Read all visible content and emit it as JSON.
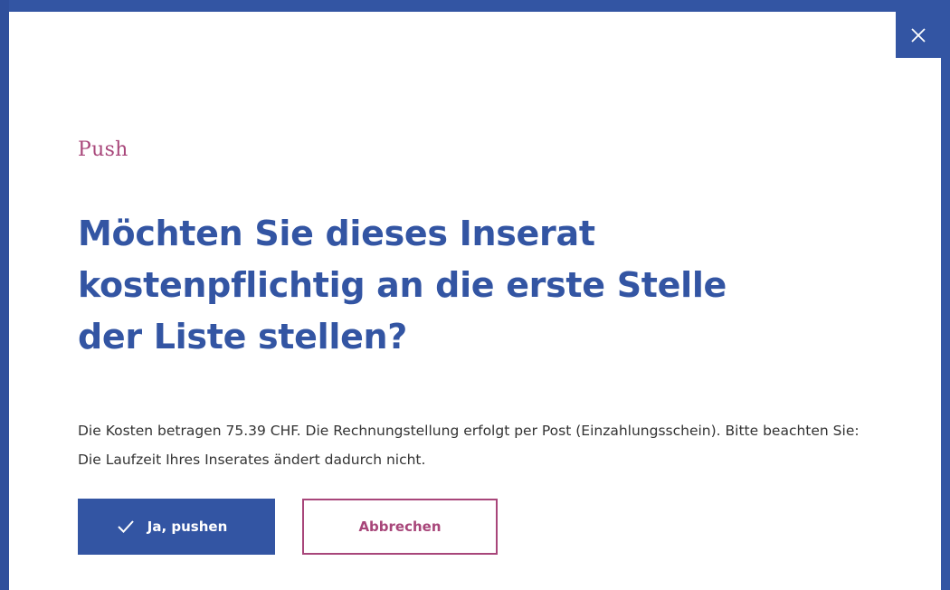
{
  "modal": {
    "eyebrow": "Push",
    "title": "Möchten Sie dieses Inserat kostenpflichtig an die erste Stelle der Liste stellen?",
    "body": "Die Kosten betragen 75.39 CHF. Die Rechnungstellung erfolgt per Post (Einzahlungsschein). Bitte beachten Sie: Die Laufzeit Ihres Inserates ändert dadurch nicht.",
    "close_icon": "close-icon",
    "confirm_icon": "check-icon",
    "confirm_label": "Ja, pushen",
    "cancel_label": "Abbrechen"
  },
  "colors": {
    "primary": "#3355a3",
    "accent": "#a8467a",
    "text": "#333333",
    "background": "#ffffff"
  }
}
